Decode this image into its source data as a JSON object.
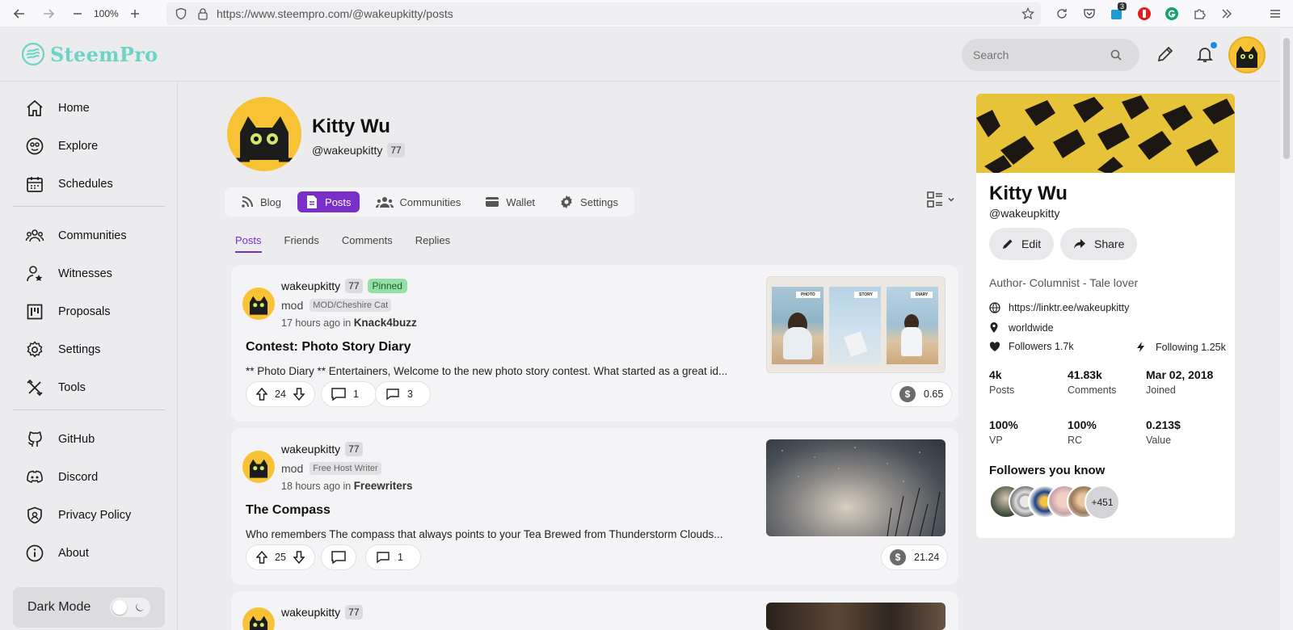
{
  "browser": {
    "zoom": "100%",
    "url": "https://www.steempro.com/@wakeupkitty/posts",
    "ext_badge": "3"
  },
  "app": {
    "logo_text": "SteemPro",
    "search_placeholder": "Search"
  },
  "sidebar": {
    "items": [
      {
        "label": "Home"
      },
      {
        "label": "Explore"
      },
      {
        "label": "Schedules"
      },
      {
        "label": "Communities"
      },
      {
        "label": "Witnesses"
      },
      {
        "label": "Proposals"
      },
      {
        "label": "Settings"
      },
      {
        "label": "Tools"
      },
      {
        "label": "GitHub"
      },
      {
        "label": "Discord"
      },
      {
        "label": "Privacy Policy"
      },
      {
        "label": "About"
      }
    ],
    "dark_mode_label": "Dark Mode"
  },
  "profile": {
    "name": "Kitty Wu",
    "handle": "@wakeupkitty",
    "reputation": "77",
    "tabs": [
      "Blog",
      "Posts",
      "Communities",
      "Wallet",
      "Settings"
    ],
    "active_tab": "Posts",
    "subtabs": [
      "Posts",
      "Friends",
      "Comments",
      "Replies"
    ]
  },
  "posts": [
    {
      "author": "wakeupkitty",
      "rep": "77",
      "pinned": "Pinned",
      "role": "mod",
      "badge": "MOD/Cheshire Cat",
      "time": "17 hours ago",
      "in_word": "in",
      "community": "Knack4buzz",
      "title": "Contest: Photo Story Diary",
      "body": "** Photo Diary ** Entertainers, Welcome to the new photo story contest. What started as a great id...",
      "thumb_labels": [
        "PHOTO",
        "STORY",
        "DIARY"
      ],
      "votes": "24",
      "comments": "1",
      "reblogs": "3",
      "payout": "0.65"
    },
    {
      "author": "wakeupkitty",
      "rep": "77",
      "role": "mod",
      "badge": "Free Host Writer",
      "time": "18 hours ago",
      "in_word": "in",
      "community": "Freewriters",
      "title": "The Compass",
      "body": "Who remembers The compass that always points to your Tea Brewed from Thunderstorm Clouds...",
      "votes": "25",
      "reblogs": "1",
      "payout": "21.24"
    },
    {
      "author": "wakeupkitty",
      "rep": "77"
    }
  ],
  "panel": {
    "name": "Kitty Wu",
    "handle": "@wakeupkitty",
    "edit_label": "Edit",
    "share_label": "Share",
    "about": "Author- Columnist - Tale lover",
    "website": "https://linktr.ee/wakeupkitty",
    "location": "worldwide",
    "followers": "Followers 1.7k",
    "following": "Following 1.25k",
    "stats": [
      {
        "value": "4k",
        "label": "Posts"
      },
      {
        "value": "41.83k",
        "label": "Comments"
      },
      {
        "value": "Mar 02, 2018",
        "label": "Joined"
      },
      {
        "value": "100%",
        "label": "VP"
      },
      {
        "value": "100%",
        "label": "RC"
      },
      {
        "value": "0.213$",
        "label": "Value"
      }
    ],
    "followers_you_know": "Followers you know",
    "more_followers": "+451"
  },
  "colors": {
    "accent": "#7b2fc9",
    "logo": "#6cd3c6",
    "avatar_bg": "#f7c233",
    "pinned": "#94dfa6"
  }
}
